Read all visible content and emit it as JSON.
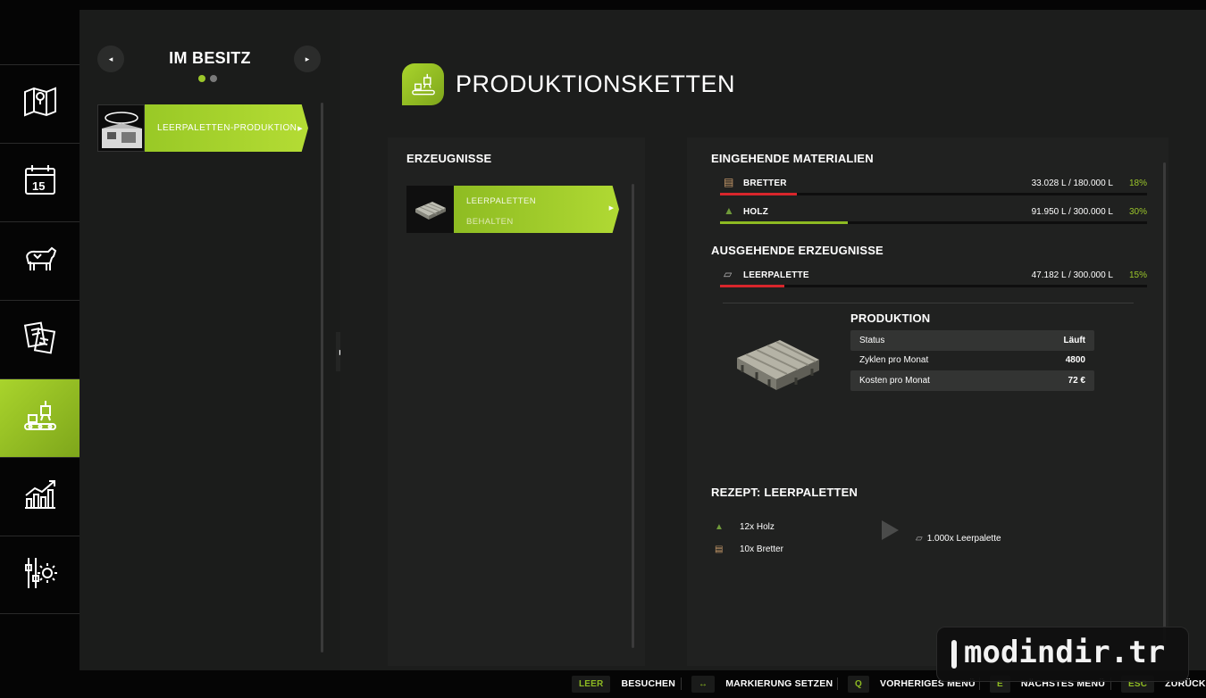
{
  "colors": {
    "accent": "#9bc62a",
    "red_bar": "#d8262b",
    "green_bar": "#8dba22",
    "background": "#1c1d1c"
  },
  "nav": {
    "items": [
      {
        "icon": "map-icon",
        "active": false
      },
      {
        "icon": "calendar-icon",
        "label": "15",
        "active": false
      },
      {
        "icon": "cow-icon",
        "active": false
      },
      {
        "icon": "contracts-icon",
        "active": false
      },
      {
        "icon": "production-icon",
        "active": true
      },
      {
        "icon": "statistics-icon",
        "active": false
      },
      {
        "icon": "settings-icon",
        "active": false
      }
    ]
  },
  "owned": {
    "title": "IM BESITZ",
    "prev_glyph": "◂",
    "next_glyph": "▸",
    "items": [
      {
        "label": "LEERPALETTEN-PRODUKTION"
      }
    ]
  },
  "header": {
    "title": "PRODUKTIONSKETTEN"
  },
  "products": {
    "title": "ERZEUGNISSE",
    "items": [
      {
        "name": "LEERPALETTEN",
        "mode": "BEHALTEN"
      }
    ]
  },
  "detail": {
    "incoming_title": "EINGEHENDE MATERIALIEN",
    "incoming": [
      {
        "name": "BRETTER",
        "amount": "33.028 L / 180.000 L",
        "percent": "18%",
        "fill": 0.18,
        "bar_color": "#d8262b",
        "icon": "planks-icon"
      },
      {
        "name": "HOLZ",
        "amount": "91.950 L / 300.000 L",
        "percent": "30%",
        "fill": 0.3,
        "bar_color": "#8dba22",
        "icon": "tree-icon"
      }
    ],
    "outgoing_title": "AUSGEHENDE ERZEUGNISSE",
    "outgoing": [
      {
        "name": "LEERPALETTE",
        "amount": "47.182 L / 300.000 L",
        "percent": "15%",
        "fill": 0.15,
        "bar_color": "#d8262b",
        "icon": "pallet-icon"
      }
    ],
    "production_title": "PRODUKTION",
    "production_rows": [
      {
        "label": "Status",
        "value": "Läuft"
      },
      {
        "label": "Zyklen pro Monat",
        "value": "4800"
      },
      {
        "label": "Kosten pro Monat",
        "value": "72 €"
      }
    ],
    "recipe_title": "REZEPT: LEERPALETTEN",
    "recipe_inputs": [
      "12x Holz",
      "10x Bretter"
    ],
    "recipe_output": "1.000x Leerpalette"
  },
  "footer": {
    "hints": [
      {
        "key": "LEER",
        "label": "BESUCHEN"
      },
      {
        "key": "↔",
        "label": "MARKIERUNG SETZEN"
      },
      {
        "key": "Q",
        "label": "VORHERIGES MENÜ"
      },
      {
        "key": "E",
        "label": "NÄCHSTES MENÜ"
      },
      {
        "key": "ESC",
        "label": "ZURÜCK"
      }
    ]
  },
  "watermark": "modindir.tr"
}
